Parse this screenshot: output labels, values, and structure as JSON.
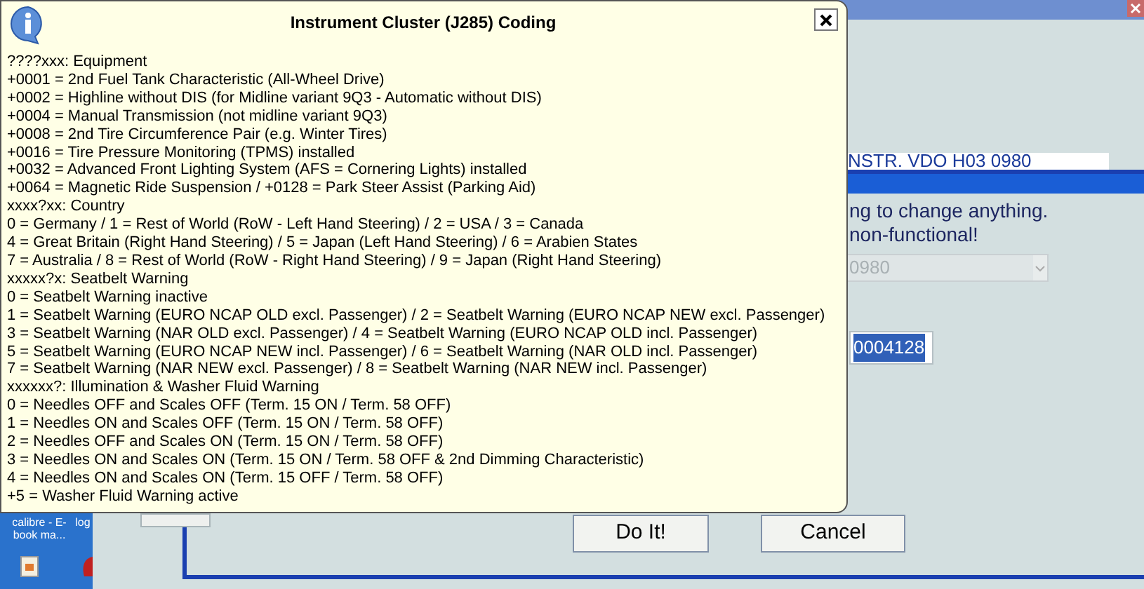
{
  "popup": {
    "title": "Instrument Cluster (J285) Coding",
    "lines": [
      "????xxx: Equipment",
      "+0001 = 2nd Fuel Tank Characteristic (All-Wheel Drive)",
      "+0002 = Highline without DIS (for Midline variant 9Q3 - Automatic without DIS)",
      "+0004 = Manual Transmission (not midline variant 9Q3)",
      "+0008 = 2nd Tire Circumference Pair (e.g. Winter Tires)",
      "+0016 = Tire Pressure Monitoring (TPMS) installed",
      "+0032 = Advanced Front Lighting System (AFS = Cornering Lights) installed",
      "+0064 = Magnetic Ride Suspension / +0128 = Park Steer Assist (Parking Aid)",
      "xxxx?xx: Country",
      "0 = Germany / 1 = Rest of World (RoW - Left Hand Steering) / 2 = USA / 3 = Canada",
      "4 = Great Britain (Right Hand Steering) / 5 = Japan (Left Hand Steering) / 6 = Arabien States",
      "7 = Australia / 8 = Rest of World (RoW - Right Hand Steering) / 9 = Japan (Right Hand Steering)",
      "xxxxx?x: Seatbelt Warning",
      "0 = Seatbelt Warning inactive",
      "1 = Seatbelt Warning (EURO NCAP OLD excl. Passenger) / 2 = Seatbelt Warning (EURO NCAP NEW excl. Passenger)",
      "3 = Seatbelt Warning (NAR OLD excl. Passenger) / 4 = Seatbelt Warning (EURO NCAP OLD incl. Passenger)",
      "5 = Seatbelt Warning (EURO NCAP NEW incl. Passenger) / 6 = Seatbelt Warning (NAR OLD incl. Passenger)",
      "7 = Seatbelt Warning (NAR NEW excl. Passenger) / 8 = Seatbelt Warning (NAR NEW incl. Passenger)",
      "xxxxxx?: Illumination & Washer Fluid Warning",
      "0 = Needles OFF and Scales OFF (Term. 15 ON / Term. 58 OFF)",
      "1 = Needles ON and Scales OFF (Term. 15 ON / Term. 58 OFF)",
      "2 = Needles OFF and Scales ON (Term. 15 ON / Term. 58 OFF)",
      "3 = Needles ON and Scales ON (Term. 15 ON / Term. 58 OFF & 2nd Dimming Characteristic)",
      "4 = Needles ON and Scales ON (Term. 15 OFF / Term. 58 OFF)",
      "+5 = Washer Fluid Warning active"
    ]
  },
  "background_window": {
    "field_text": "NSTR. VDO H03 0980"
  },
  "dialog": {
    "message_lines": [
      "ng to change anything.",
      "non-functional!"
    ],
    "dropdown": {
      "value": "0980",
      "disabled": true
    },
    "coding_field": {
      "value": "0004128",
      "selected": true
    },
    "buttons": [
      "Do It!",
      "Cancel"
    ]
  },
  "desktop": {
    "icons": [
      {
        "label": "calibre - E-book ma..."
      },
      {
        "label": "log"
      }
    ]
  }
}
